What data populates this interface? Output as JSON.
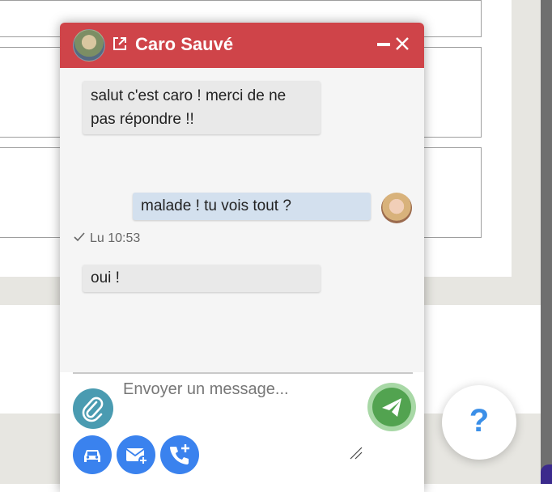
{
  "chat": {
    "contact_name": "Caro Sauvé",
    "messages": [
      {
        "direction": "incoming",
        "lines": [
          "salut c'est caro ! merci de ne",
          "pas répondre !!"
        ]
      },
      {
        "direction": "outgoing",
        "text": "malade ! tu vois tout ?",
        "status": "Lu 10:53"
      },
      {
        "direction": "incoming",
        "text": "oui !"
      }
    ],
    "composer": {
      "placeholder": "Envoyer un message..."
    },
    "icons": {
      "external": "external-link-icon",
      "minimize": "minimize-icon",
      "close": "close-icon",
      "attach": "paperclip-icon",
      "send": "paper-plane-icon",
      "car": "car-icon",
      "mail_add": "mail-plus-icon",
      "phone_add": "phone-plus-icon",
      "read": "check-icon"
    }
  },
  "help": {
    "label": "?"
  },
  "colors": {
    "header": "#cf4449",
    "incoming_bubble": "#e9e9e9",
    "outgoing_bubble": "#d3e0ee",
    "attach": "#4a9bb1",
    "send": "#52a350",
    "action": "#3a82ee",
    "help": "#3b8fe8"
  }
}
